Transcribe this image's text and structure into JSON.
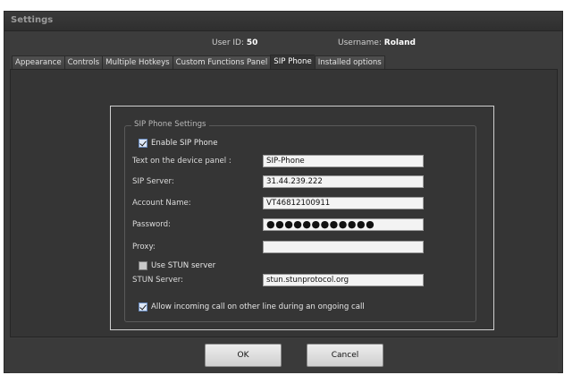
{
  "window": {
    "title": "Settings"
  },
  "user": {
    "id_label": "User ID:",
    "id_value": "50",
    "name_label": "Username:",
    "name_value": "Roland"
  },
  "tabs": [
    {
      "label": "Appearance",
      "active": false
    },
    {
      "label": "Controls",
      "active": false
    },
    {
      "label": "Multiple Hotkeys",
      "active": false
    },
    {
      "label": "Custom Functions Panel",
      "active": false
    },
    {
      "label": "SIP Phone",
      "active": true
    },
    {
      "label": "Installed options",
      "active": false
    }
  ],
  "sip": {
    "group_title": "SIP Phone Settings",
    "enable": {
      "label": "Enable SIP Phone",
      "checked": true
    },
    "device_text": {
      "label": "Text on the device panel :",
      "value": "SIP-Phone"
    },
    "server": {
      "label": "SIP Server:",
      "value": "31.44.239.222"
    },
    "account": {
      "label": "Account Name:",
      "value": "VT46812100911"
    },
    "password": {
      "label": "Password:",
      "value": "●●●●●●●●●●●●"
    },
    "proxy": {
      "label": "Proxy:",
      "value": ""
    },
    "use_stun": {
      "label": "Use STUN server",
      "checked": false
    },
    "stun_server": {
      "label": "STUN Server:",
      "value": "stun.stunprotocol.org"
    },
    "allow_incoming": {
      "label": "Allow incoming call on other line during an ongoing call",
      "checked": true
    }
  },
  "buttons": {
    "ok": "OK",
    "cancel": "Cancel"
  },
  "colors": {
    "background": "#3c3c3c",
    "panel": "#353535",
    "field": "#f3f3f3",
    "checkbox": "#dfe8f6"
  }
}
